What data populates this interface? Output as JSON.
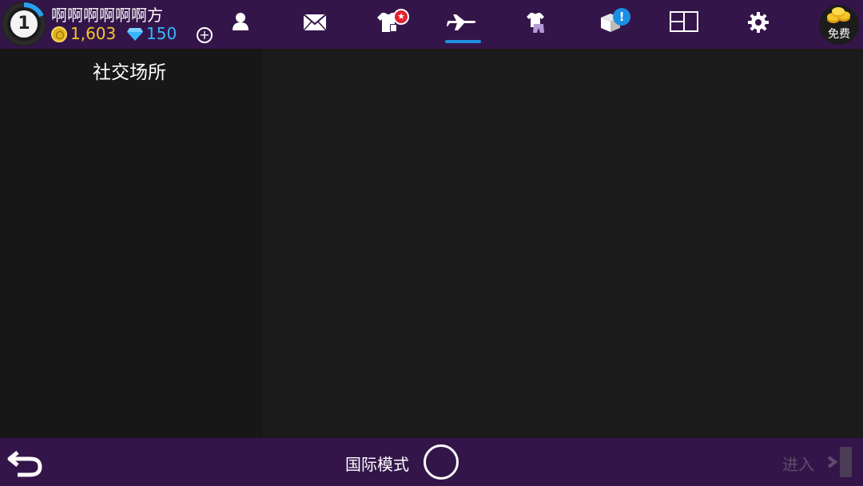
{
  "player": {
    "level": "1",
    "name": "啊啊啊啊啊啊方",
    "coins": "1,603",
    "gems": "150"
  },
  "nav": {
    "items": [
      {
        "id": "profile",
        "icon": "person-icon"
      },
      {
        "id": "mail",
        "icon": "envelope-icon"
      },
      {
        "id": "shop",
        "icon": "tshirt-tag-icon",
        "badge": "star"
      },
      {
        "id": "travel",
        "icon": "airplane-icon",
        "active": true
      },
      {
        "id": "wardrobe",
        "icon": "outfit-icon"
      },
      {
        "id": "boxes",
        "icon": "box-icon",
        "badge": "!"
      },
      {
        "id": "layout",
        "icon": "layout-icon"
      },
      {
        "id": "settings",
        "icon": "gear-icon"
      }
    ],
    "badge_alert": "!",
    "free_label": "免费"
  },
  "sidebar": {
    "title": "社交场所"
  },
  "footer": {
    "mode_label": "国际模式",
    "enter_label": "进入"
  },
  "colors": {
    "bar": "#34154a",
    "accent": "#1f8fe6",
    "coin": "#f5c626",
    "gem": "#39b6ff"
  }
}
